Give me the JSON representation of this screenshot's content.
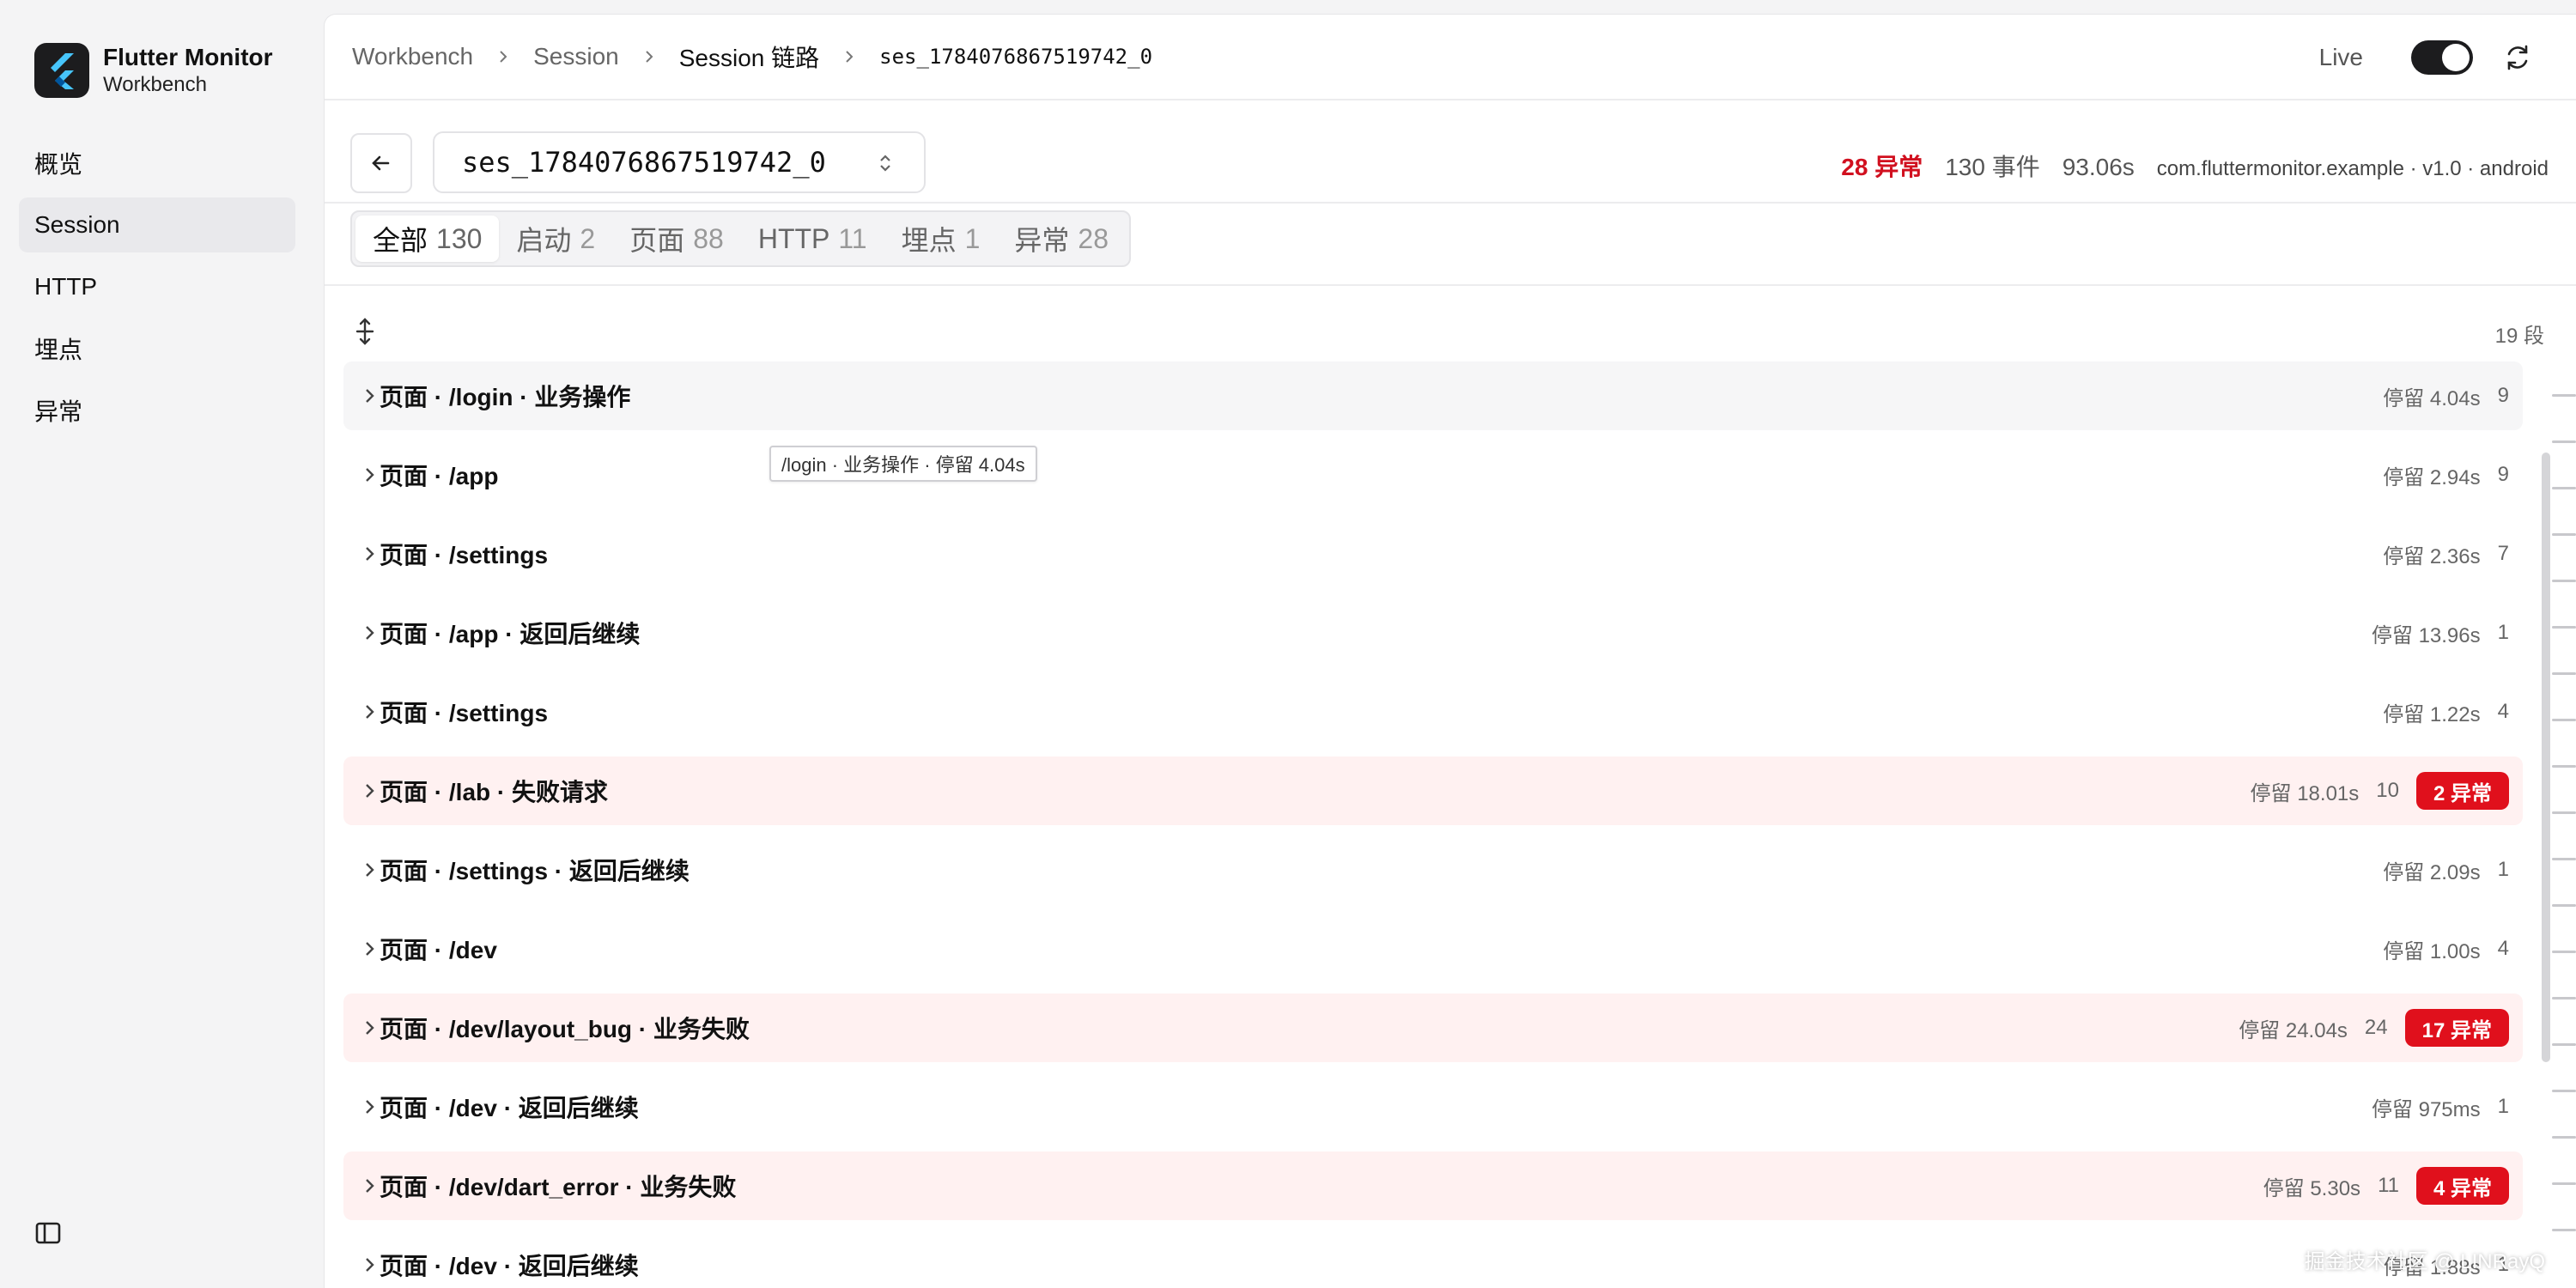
{
  "sidebar": {
    "brand_title": "Flutter Monitor",
    "brand_subtitle": "Workbench",
    "items": [
      {
        "label": "概览"
      },
      {
        "label": "Session"
      },
      {
        "label": "HTTP"
      },
      {
        "label": "埋点"
      },
      {
        "label": "异常"
      }
    ],
    "active_item": "Session"
  },
  "header": {
    "breadcrumb": [
      "Workbench",
      "Session",
      "Session 链路",
      "ses_1784076867519742_0"
    ],
    "live_label": "Live",
    "live_enabled": true
  },
  "session": {
    "selected": "ses_1784076867519742_0",
    "error_count_label": "28 异常",
    "event_count_label": "130 事件",
    "duration_label": "93.06s",
    "app_info": "com.fluttermonitor.example · v1.0 · android"
  },
  "filters": [
    {
      "label": "全部",
      "count": "130"
    },
    {
      "label": "启动",
      "count": "2"
    },
    {
      "label": "页面",
      "count": "88"
    },
    {
      "label": "HTTP",
      "count": "11"
    },
    {
      "label": "埋点",
      "count": "1"
    },
    {
      "label": "异常",
      "count": "28"
    }
  ],
  "segments_label": "19 段",
  "tooltip_text": "/login · 业务操作 · 停留 4.04s",
  "rows": [
    {
      "title": "页面 · /login · 业务操作",
      "duration": "停留 4.04s",
      "count": "9",
      "badge": ""
    },
    {
      "title": "页面 · /app",
      "duration": "停留 2.94s",
      "count": "9",
      "badge": ""
    },
    {
      "title": "页面 · /settings",
      "duration": "停留 2.36s",
      "count": "7",
      "badge": ""
    },
    {
      "title": "页面 · /app · 返回后继续",
      "duration": "停留 13.96s",
      "count": "1",
      "badge": ""
    },
    {
      "title": "页面 · /settings",
      "duration": "停留 1.22s",
      "count": "4",
      "badge": ""
    },
    {
      "title": "页面 · /lab · 失败请求",
      "duration": "停留 18.01s",
      "count": "10",
      "badge": "2 异常"
    },
    {
      "title": "页面 · /settings · 返回后继续",
      "duration": "停留 2.09s",
      "count": "1",
      "badge": ""
    },
    {
      "title": "页面 · /dev",
      "duration": "停留 1.00s",
      "count": "4",
      "badge": ""
    },
    {
      "title": "页面 · /dev/layout_bug · 业务失败",
      "duration": "停留 24.04s",
      "count": "24",
      "badge": "17 异常"
    },
    {
      "title": "页面 · /dev · 返回后继续",
      "duration": "停留 975ms",
      "count": "1",
      "badge": ""
    },
    {
      "title": "页面 · /dev/dart_error · 业务失败",
      "duration": "停留 5.30s",
      "count": "11",
      "badge": "4 异常"
    },
    {
      "title": "页面 · /dev · 返回后继续",
      "duration": "停留 1.88s",
      "count": "1",
      "badge": ""
    }
  ],
  "colors": {
    "accent_error": "#e0101c",
    "error_row_bg": "#fff1f1",
    "sidebar_bg": "#f4f4f5"
  },
  "watermark": "掘金技术社区 @ LINRayQ"
}
